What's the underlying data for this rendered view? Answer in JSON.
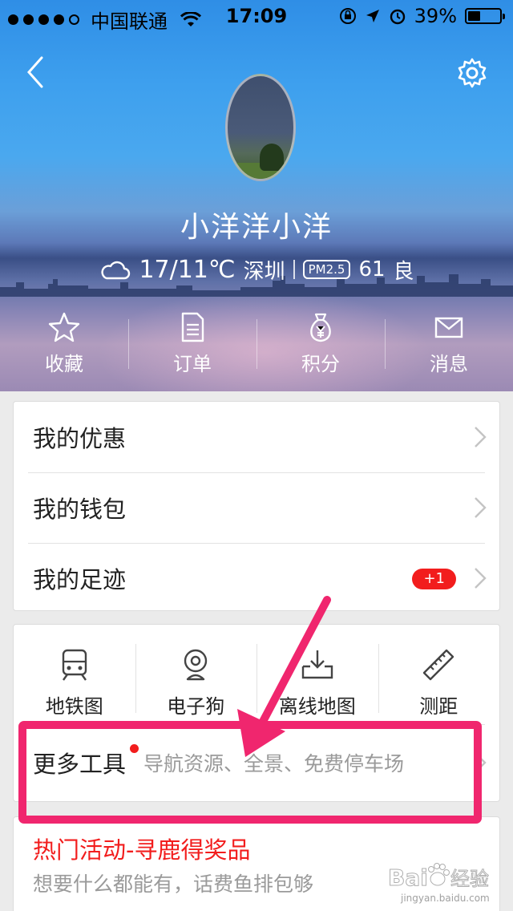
{
  "status_bar": {
    "carrier": "中国联通",
    "time": "17:09",
    "battery": "39%",
    "battery_level": 0.39
  },
  "header": {
    "back_icon": "chevron-left-icon",
    "settings_icon": "gear-icon",
    "username": "小洋洋小洋",
    "weather": {
      "icon": "cloud-icon",
      "temperature": "17/11℃",
      "city": "深圳",
      "pm_label": "PM2.5",
      "pm_value": "61",
      "air_quality": "良"
    }
  },
  "quick_actions": [
    {
      "label": "收藏",
      "icon": "star-icon"
    },
    {
      "label": "订单",
      "icon": "document-icon"
    },
    {
      "label": "积分",
      "icon": "money-bag-icon"
    },
    {
      "label": "消息",
      "icon": "envelope-icon"
    }
  ],
  "menu_list": [
    {
      "label": "我的优惠"
    },
    {
      "label": "我的钱包"
    },
    {
      "label": "我的足迹",
      "badge": "+1"
    }
  ],
  "tools": [
    {
      "label": "地铁图",
      "icon": "subway-icon"
    },
    {
      "label": "电子狗",
      "icon": "camera-icon"
    },
    {
      "label": "离线地图",
      "icon": "download-map-icon"
    },
    {
      "label": "测距",
      "icon": "ruler-icon"
    }
  ],
  "more_tools": {
    "title": "更多工具",
    "subtitle": "导航资源、全景、免费停车场"
  },
  "activity": {
    "title": "热门活动-寻鹿得奖品",
    "subtitle": "想要什么都能有，话费鱼排包够"
  },
  "colors": {
    "accent_red": "#f21d1d",
    "annotation_pink": "#f0266e",
    "header_blue": "#3ea0ee"
  },
  "watermark": {
    "brand": "Bai",
    "cn": "经验",
    "url": "jingyan.baidu.com"
  }
}
